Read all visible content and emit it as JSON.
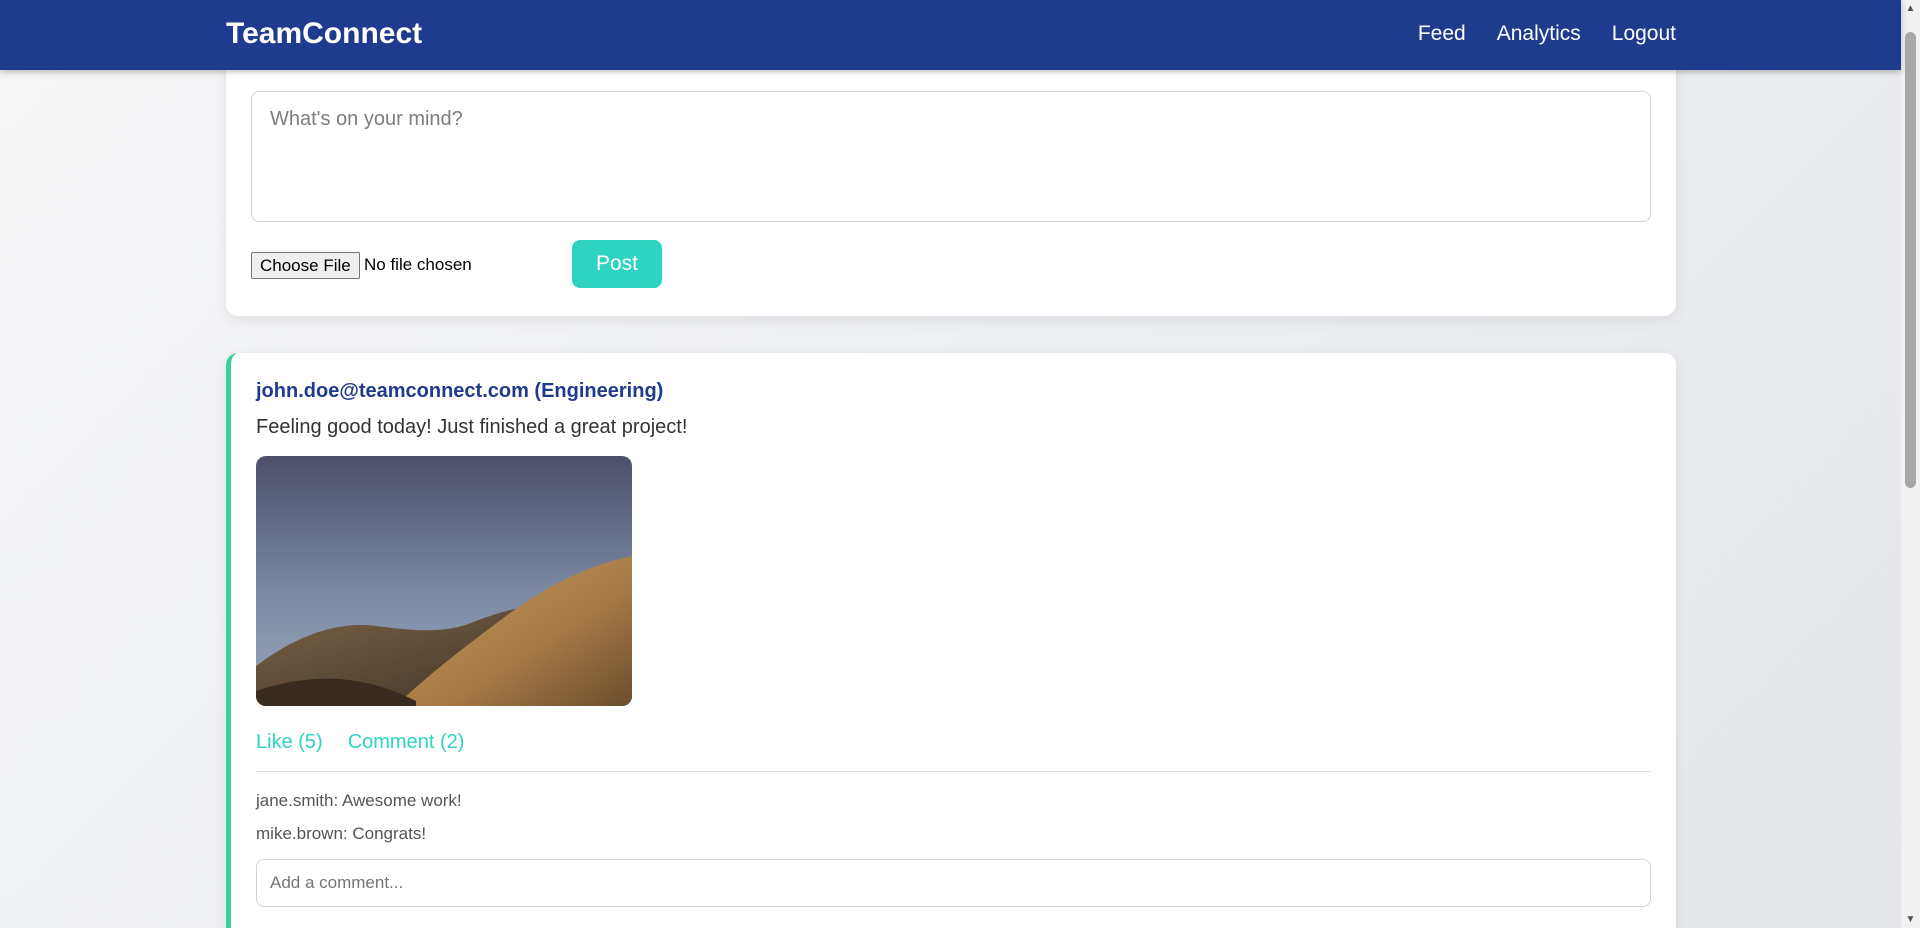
{
  "nav": {
    "brand": "TeamConnect",
    "links": [
      "Feed",
      "Analytics",
      "Logout"
    ]
  },
  "composer": {
    "placeholder": "What's on your mind?",
    "file_button": "Choose File",
    "file_status": "No file chosen",
    "post_label": "Post"
  },
  "post": {
    "author": "john.doe@teamconnect.com (Engineering)",
    "text": "Feeling good today! Just finished a great project!",
    "image_icon": "landscape-photo",
    "like_label": "Like (5)",
    "comment_label": "Comment (2)",
    "comments": [
      "jane.smith: Awesome work!",
      "mike.brown: Congrats!"
    ],
    "comment_placeholder": "Add a comment..."
  },
  "colors": {
    "navbar": "#1f3b8e",
    "accent": "#2ed3c1",
    "post_border": "#35d39b",
    "author": "#1f3b8e"
  }
}
